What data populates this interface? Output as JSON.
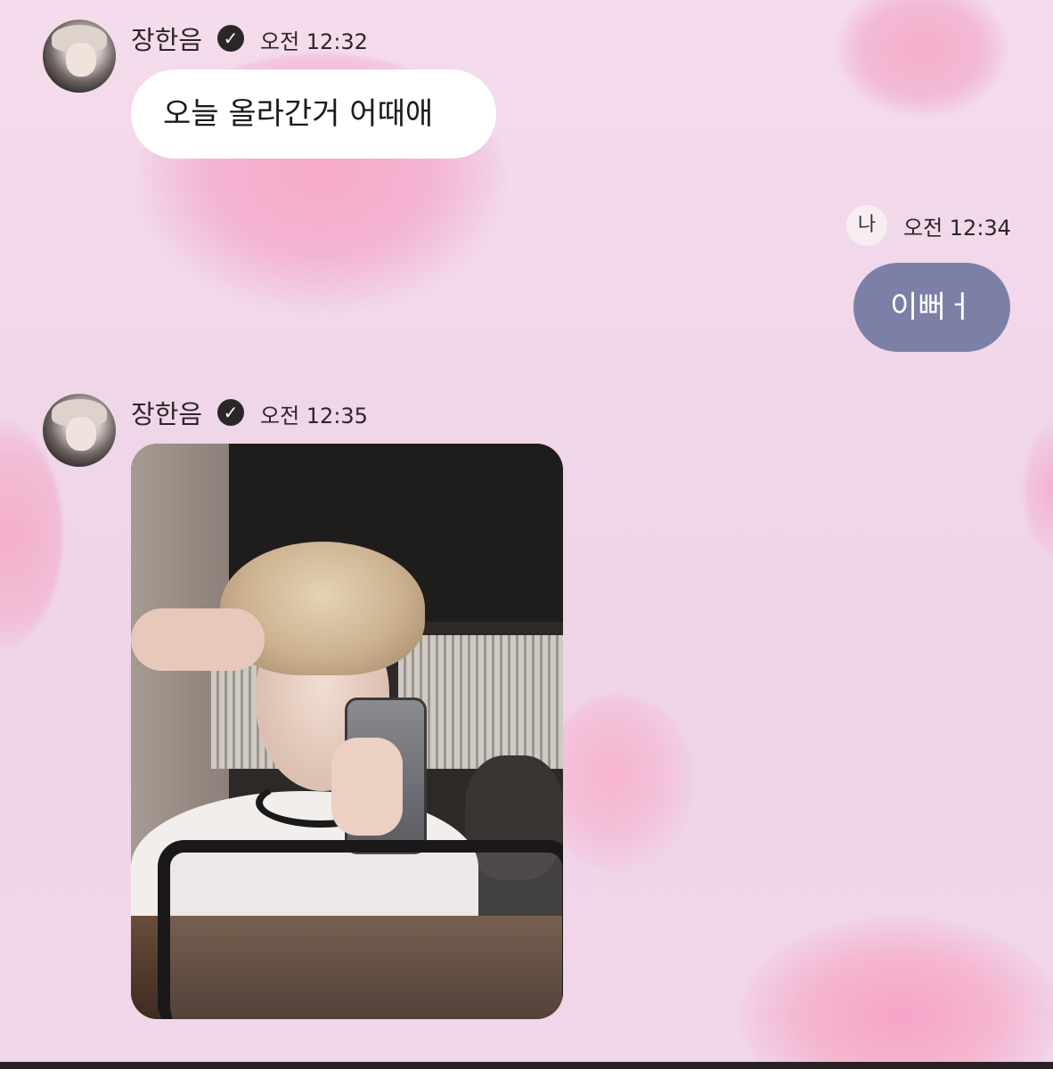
{
  "messages": [
    {
      "sender": "장한음",
      "verified": true,
      "time": "오전 12:32",
      "text": "오늘 올라간거 어때애"
    },
    {
      "sender": "나",
      "time": "오전 12:34",
      "text": "이뻐ㅓ"
    },
    {
      "sender": "장한음",
      "verified": true,
      "time": "오전 12:35",
      "image": "selfie-photo"
    }
  ],
  "icons": {
    "verified": "verified-check-icon"
  },
  "colors": {
    "background": "#f2d9ea",
    "incoming_bubble": "#ffffff",
    "outgoing_bubble": "#7c80a7"
  }
}
